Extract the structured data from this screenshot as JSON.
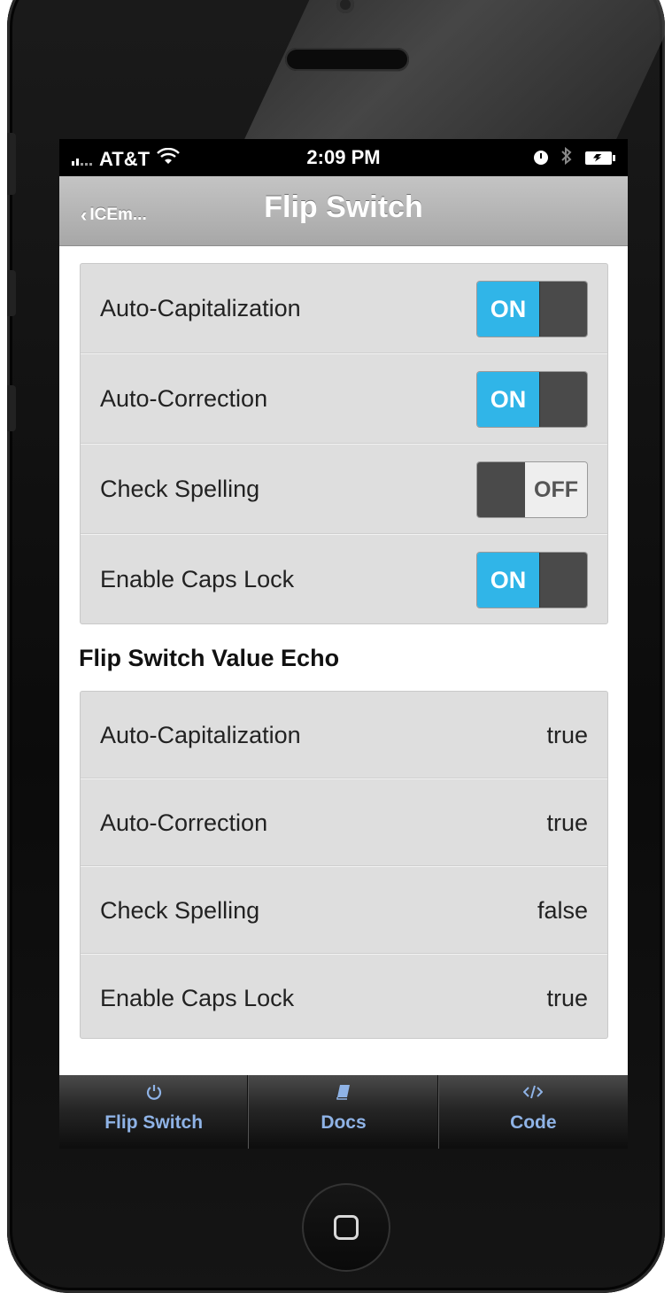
{
  "status_bar": {
    "carrier": "AT&T",
    "time": "2:09 PM"
  },
  "nav": {
    "back_label": "ICEm...",
    "title": "Flip Switch"
  },
  "switches": [
    {
      "label": "Auto-Capitalization",
      "state": "ON"
    },
    {
      "label": "Auto-Correction",
      "state": "ON"
    },
    {
      "label": "Check Spelling",
      "state": "OFF"
    },
    {
      "label": "Enable Caps Lock",
      "state": "ON"
    }
  ],
  "echo": {
    "header": "Flip Switch Value Echo",
    "rows": [
      {
        "label": "Auto-Capitalization",
        "value": "true"
      },
      {
        "label": "Auto-Correction",
        "value": "true"
      },
      {
        "label": "Check Spelling",
        "value": "false"
      },
      {
        "label": "Enable Caps Lock",
        "value": "true"
      }
    ]
  },
  "tabs": [
    {
      "label": "Flip Switch",
      "icon": "power-icon"
    },
    {
      "label": "Docs",
      "icon": "book-icon"
    },
    {
      "label": "Code",
      "icon": "code-icon"
    }
  ],
  "colors": {
    "toggle_on": "#30b5e8",
    "tab_text": "#8fb3e6"
  }
}
